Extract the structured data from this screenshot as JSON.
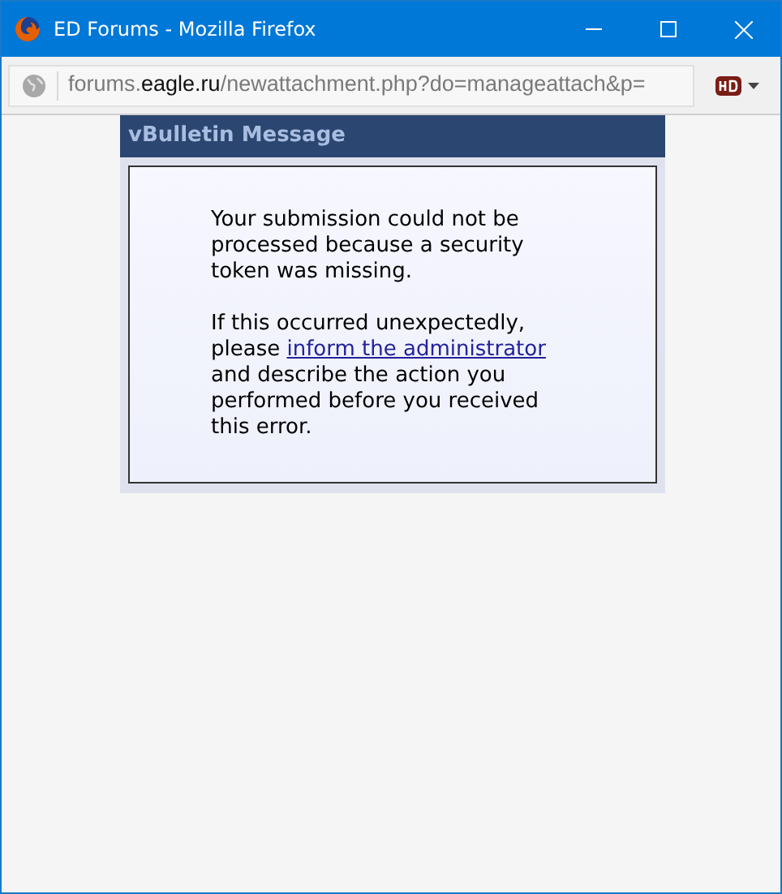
{
  "window": {
    "title": "ED Forums - Mozilla Firefox"
  },
  "address_bar": {
    "url_parts": [
      {
        "text": "forums.",
        "kind": "dim"
      },
      {
        "text": "eagle.ru",
        "kind": "domain"
      },
      {
        "text": "/newattachment.php?do=manageattach&p=",
        "kind": "dim"
      }
    ]
  },
  "message": {
    "title": "vBulletin Message",
    "paragraphs": [
      {
        "before": "Your submission could not be processed because a security token was missing."
      },
      {
        "before": "If this occurred unexpectedly, please",
        "link": "inform the administrator",
        "after": "and describe the action you performed before you received this error."
      }
    ]
  }
}
